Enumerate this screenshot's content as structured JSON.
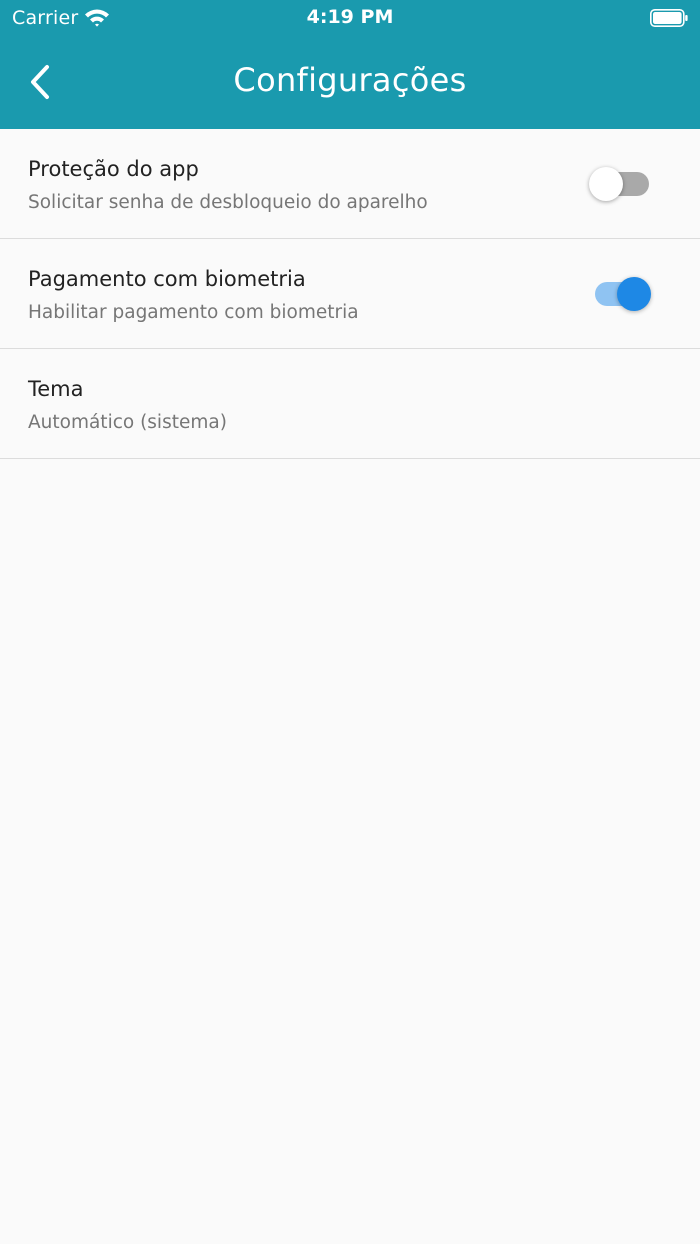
{
  "status_bar": {
    "carrier": "Carrier",
    "time": "4:19 PM"
  },
  "header": {
    "title": "Configurações",
    "background_color": "#1a9aae"
  },
  "settings": [
    {
      "title": "Proteção do app",
      "subtitle": "Solicitar senha de desbloqueio do aparelho",
      "toggle": false
    },
    {
      "title": "Pagamento com biometria",
      "subtitle": "Habilitar pagamento com biometria",
      "toggle": true
    },
    {
      "title": "Tema",
      "subtitle": "Automático (sistema)"
    }
  ],
  "icons": {
    "back": "chevron-left-icon",
    "wifi": "wifi-icon",
    "battery": "battery-icon"
  },
  "colors": {
    "toggle_on_thumb": "#1e88e5",
    "toggle_on_track": "#8fc3f2",
    "toggle_off_track": "#a9a9a9"
  }
}
